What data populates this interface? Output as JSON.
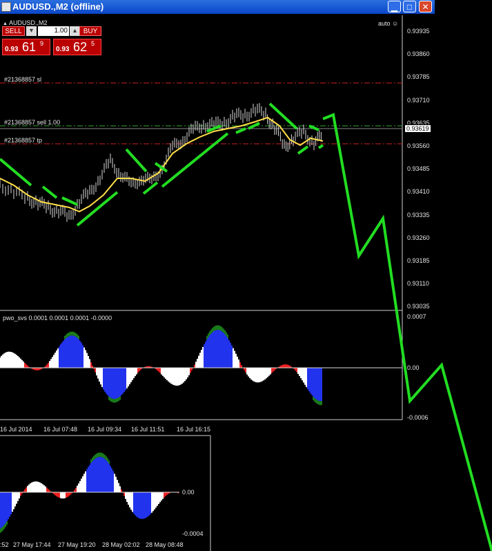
{
  "window": {
    "title": "AUDUSD.,M2 (offline)"
  },
  "symbol_label": "AUDUSD.,M2",
  "auto_label": "auto",
  "trade": {
    "sell_label": "SELL",
    "buy_label": "BUY",
    "lot": "1.00",
    "sell_price_small": "0.93",
    "sell_price_big": "61",
    "sell_price_sup": "9",
    "buy_price_small": "0.93",
    "buy_price_big": "62",
    "buy_price_sup": "5"
  },
  "order_lines": {
    "sl": "#21368857 sl",
    "sell": "#21368857 sell 1.00",
    "tp": "#21368857 tp"
  },
  "price_axis": [
    "0.93935",
    "0.93860",
    "0.93785",
    "0.93710",
    "0.93635",
    "0.93560",
    "0.93485",
    "0.93410",
    "0.93335",
    "0.93260",
    "0.93185",
    "0.93110",
    "0.93035"
  ],
  "current_price": "0.93619",
  "indicator": {
    "label": "pwo_svs 0.0001 0.0001 0.0001 -0.0000",
    "axis": [
      "0.0007",
      "0.00",
      "-0.0006"
    ]
  },
  "time_axis": [
    "16 Jul 2014",
    "16 Jul 07:48",
    "16 Jul 09:34",
    "16 Jul 11:51",
    "16 Jul 16:15"
  ],
  "second_window": {
    "axis": [
      "0.00",
      "-0.0004"
    ],
    "time_axis": [
      ":52",
      "27 May 17:44",
      "27 May 19:20",
      "28 May 02:02",
      "28 May 08:48"
    ]
  },
  "colors": {
    "grid": "#888888",
    "sl": "#cc2222",
    "sell": "#33aa33",
    "ma_green": "#22dd22",
    "ma_yellow": "#ffe04a"
  }
}
